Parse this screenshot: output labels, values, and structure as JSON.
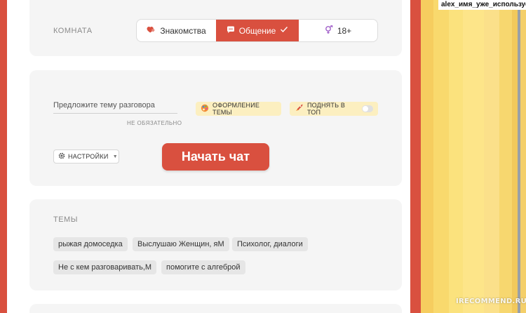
{
  "room": {
    "label": "КОМНАТА",
    "options": [
      {
        "label": "Знакомства",
        "icon": "hearts-icon"
      },
      {
        "label": "Общение",
        "icon": "chat-bubble-icon",
        "selected": true
      },
      {
        "label": "18+",
        "icon": "gender-icon"
      }
    ]
  },
  "chat": {
    "topic_placeholder": "Предложите тему разговора",
    "topic_hint": "НЕ ОБЯЗАТЕЛЬНО",
    "theme_button": "ОФОРМЛЕНИЕ ТЕМЫ",
    "raise_button": "ПОДНЯТЬ В ТОП",
    "settings_button": "НАСТРОЙКИ",
    "start_button": "Начать чат"
  },
  "topics": {
    "label": "ТЕМЫ",
    "items": [
      "рыжая домоседка",
      "Выслушаю Женщин, яМ",
      "Психолог, диалоги",
      "Не с кем разговаривать,М",
      "помогите с алгеброй"
    ]
  },
  "side": {
    "message": "alex_имя_уже_используется"
  },
  "watermark": "IRECOMMEND.RU",
  "colors": {
    "accent": "#d9503f",
    "card_bg": "#f5f5f5",
    "chip_bg": "#fcefc0",
    "tag_bg": "#e6e6e6"
  }
}
